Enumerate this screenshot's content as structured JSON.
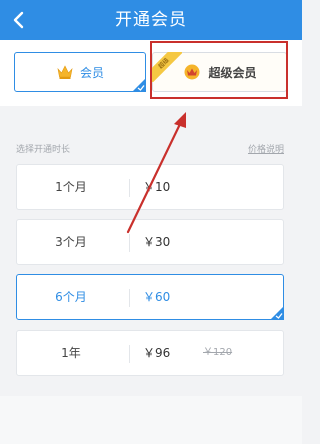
{
  "header": {
    "title": "开通会员",
    "back_icon": "chevron-left-icon"
  },
  "tiers": [
    {
      "label": "会员",
      "icon": "crown-icon",
      "selected": true
    },
    {
      "label": "超级会员",
      "icon": "crown-icon",
      "ribbon": "超级"
    }
  ],
  "duration_section": {
    "label": "选择开通时长",
    "price_note": "价格说明"
  },
  "plans": [
    {
      "duration": "1个月",
      "price": "￥10"
    },
    {
      "duration": "3个月",
      "price": "￥30"
    },
    {
      "duration": "6个月",
      "price": "￥60",
      "selected": true
    },
    {
      "duration": "1年",
      "price": "￥96",
      "old_price": "￥120"
    }
  ],
  "colors": {
    "accent": "#2f8de4",
    "annotation": "#c9302c",
    "crown": "#f5b42a"
  }
}
